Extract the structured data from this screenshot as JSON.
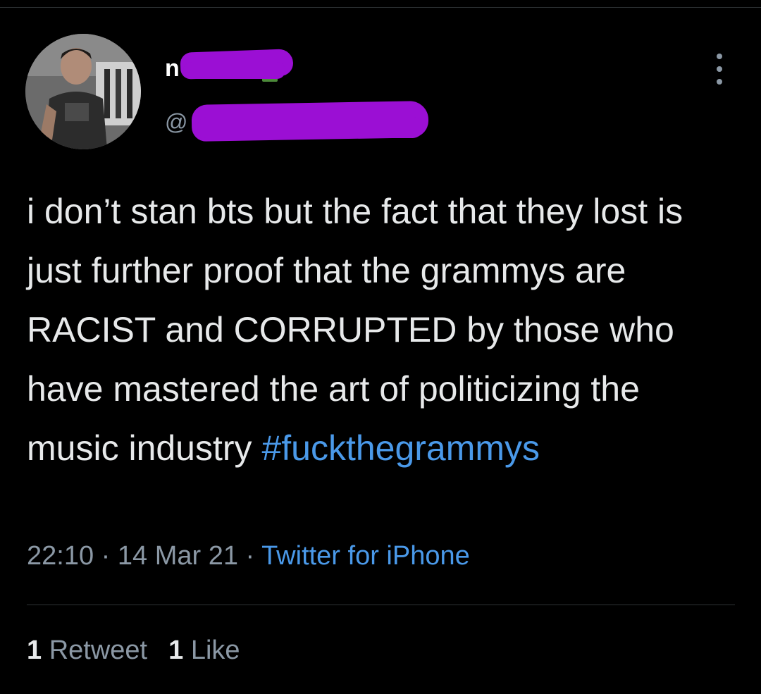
{
  "author": {
    "display_name": "n",
    "handle": "@"
  },
  "tweet": {
    "text": "i don’t stan bts but the fact that they lost is just further proof that the grammys are RACIST and CORRUPTED by those who have mastered the art of politicizing the music industry ",
    "hashtag": "#fuckthegrammys",
    "time": "22:10",
    "sep1": " · ",
    "date": "14 Mar 21",
    "sep2": " · ",
    "source": "Twitter for iPhone"
  },
  "stats": {
    "retweets_count": "1",
    "retweets_label": "Retweet",
    "likes_count": "1",
    "likes_label": "Like"
  },
  "icons": {
    "more": "more-vertical-icon"
  },
  "colors": {
    "background": "#000000",
    "text": "#e7e9ea",
    "secondary": "#8b98a5",
    "link": "#4a99e9",
    "redaction": "#9b0fd4"
  }
}
